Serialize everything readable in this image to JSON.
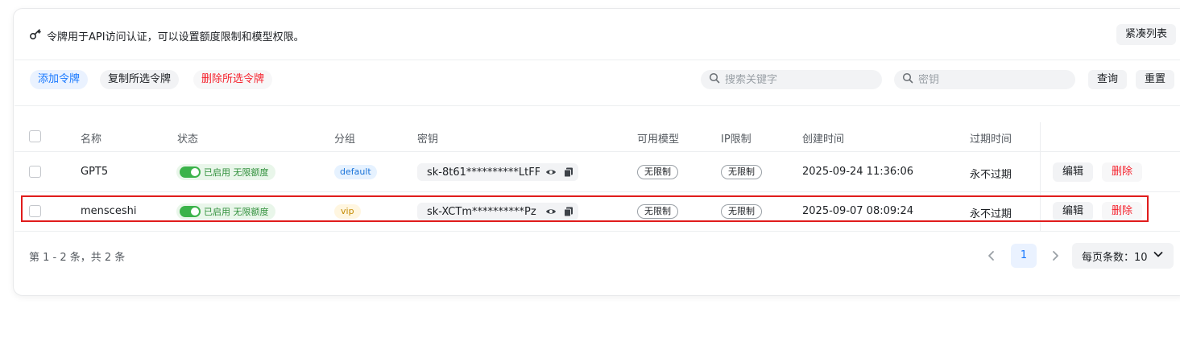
{
  "header": {
    "notice_icon": "key-icon",
    "notice_text": "令牌用于API访问认证，可以设置额度限制和模型权限。",
    "compact_label": "紧凑列表"
  },
  "toolbar": {
    "add_label": "添加令牌",
    "copy_label": "复制所选令牌",
    "delete_label": "删除所选令牌",
    "keyword_placeholder": "搜索关键字",
    "key_placeholder": "密钥",
    "query_label": "查询",
    "reset_label": "重置"
  },
  "table": {
    "columns": [
      "名称",
      "状态",
      "分组",
      "密钥",
      "可用模型",
      "IP限制",
      "创建时间",
      "过期时间"
    ],
    "rows": [
      {
        "name": "GPT5",
        "status": "已启用 无限额度",
        "group": "default",
        "key": "sk-8t61**********LtFF",
        "models": "无限制",
        "ip": "无限制",
        "created": "2025-09-24 11:36:06",
        "expires": "永不过期",
        "edit": "编辑",
        "delete": "删除"
      },
      {
        "name": "mensceshi",
        "status": "已启用 无限额度",
        "group": "vip",
        "key": "sk-XCTm**********Pz",
        "models": "无限制",
        "ip": "无限制",
        "created": "2025-09-07 08:09:24",
        "expires": "永不过期",
        "edit": "编辑",
        "delete": "删除"
      }
    ]
  },
  "pagination": {
    "info": "第 1 - 2 条，共 2 条",
    "current_page": "1",
    "page_size_label": "每页条数：10"
  },
  "colors": {
    "accent": "#1677ff",
    "danger": "#f5222d",
    "success": "#3bb34a",
    "highlight_border": "#e01c1c"
  }
}
